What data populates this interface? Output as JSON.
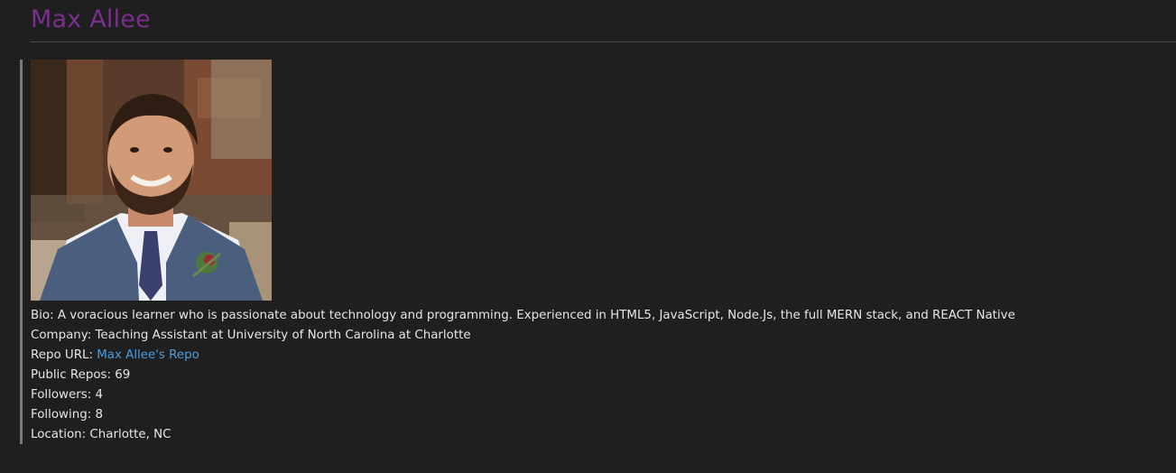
{
  "profile": {
    "name": "Max Allee",
    "avatar_icon": "profile-photo",
    "bio_label": "Bio:",
    "bio": "A voracious learner who is passionate about technology and programming. Experienced in HTML5, JavaScript, Node.Js, the full MERN stack, and REACT Native",
    "company_label": "Company:",
    "company": "Teaching Assistant at University of North Carolina at Charlotte",
    "repo_label": "Repo URL:",
    "repo_link_text": "Max Allee's Repo",
    "public_repos_label": "Public Repos:",
    "public_repos": "69",
    "followers_label": "Followers:",
    "followers": "4",
    "following_label": "Following:",
    "following": "8",
    "location_label": "Location:",
    "location": "Charlotte, NC"
  },
  "colors": {
    "background": "#1f1f1f",
    "title": "#7b2f8c",
    "text": "#e6e6e6",
    "link": "#4a9fe0",
    "quote_border": "#7a7a7a"
  }
}
